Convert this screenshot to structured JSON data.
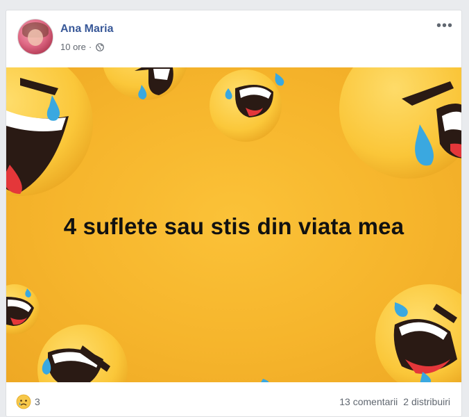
{
  "post": {
    "author": "Ana Maria",
    "timestamp": "10 ore",
    "separator": "·",
    "privacy_icon": "globe-icon",
    "more_icon": "more-options-icon",
    "more_label": "•••",
    "image_text": "4 suflete sau stis din viata mea",
    "image_background_icon": "laughing-crying-emoji",
    "colors": {
      "author": "#385898",
      "image_background": "#f6b52c",
      "emoji_face": "#fbcd3a",
      "tear": "#36a9e1"
    }
  },
  "footer": {
    "reaction_icon": "sad-face-icon",
    "reaction_count": "3",
    "comments": "13 comentarii",
    "shares": "2 distribuiri"
  }
}
